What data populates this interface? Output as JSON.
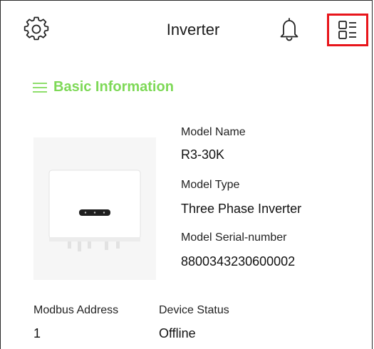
{
  "header": {
    "title": "Inverter",
    "icons": {
      "settings": "gear-icon",
      "notifications": "bell-icon",
      "detail_list": "list-detail-icon"
    },
    "highlight_color": "#e8151b"
  },
  "basic_info": {
    "heading": "Basic Information",
    "heading_color": "#7ed957",
    "model_name_label": "Model Name",
    "model_name": "R3-30K",
    "model_type_label": "Model Type",
    "model_type": "Three Phase Inverter",
    "serial_label": "Model Serial-number",
    "serial": "8800343230600002",
    "modbus_label": "Modbus Address",
    "modbus": "1",
    "status_label": "Device Status",
    "status": "Offline"
  }
}
